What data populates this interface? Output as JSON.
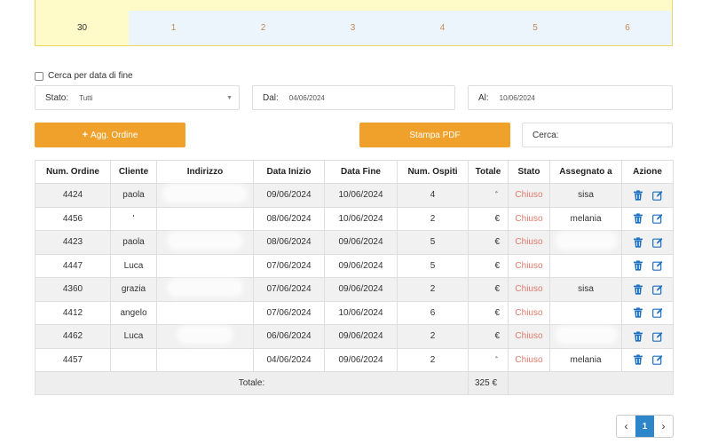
{
  "calendar": {
    "days": [
      "30",
      "1",
      "2",
      "3",
      "4",
      "5",
      "6"
    ]
  },
  "filters": {
    "end_date_checkbox_label": "Cerca per data di fine",
    "stato_label": "Stato:",
    "stato_value": "Tutti",
    "dal_label": "Dal:",
    "dal_value": "04/06/2024",
    "al_label": "Al:",
    "al_value": "10/06/2024"
  },
  "buttons": {
    "add_order": "Agg. Ordine",
    "print_pdf": "Stampa PDF"
  },
  "search": {
    "label": "Cerca:"
  },
  "table": {
    "headers": [
      "Num. Ordine",
      "Cliente",
      "Indirizzo",
      "Data Inizio",
      "Data Fine",
      "Num. Ospiti",
      "Totale",
      "Stato",
      "Assegnato a",
      "Azione"
    ],
    "rows": [
      {
        "num": "4424",
        "cliente": "paola",
        "inizio": "09/06/2024",
        "fine": "10/06/2024",
        "ospiti": "4",
        "totale": "ﾞ",
        "stato": "Chiuso",
        "assegnato": "sisa"
      },
      {
        "num": "4456",
        "cliente": "'",
        "inizio": "08/06/2024",
        "fine": "10/06/2024",
        "ospiti": "2",
        "totale": "€",
        "stato": "Chiuso",
        "assegnato": "melania"
      },
      {
        "num": "4423",
        "cliente": "paola",
        "inizio": "08/06/2024",
        "fine": "09/06/2024",
        "ospiti": "5",
        "totale": "€",
        "stato": "Chiuso",
        "assegnato": ""
      },
      {
        "num": "4447",
        "cliente": "Luca",
        "inizio": "07/06/2024",
        "fine": "09/06/2024",
        "ospiti": "5",
        "totale": "€",
        "stato": "Chiuso",
        "assegnato": ""
      },
      {
        "num": "4360",
        "cliente": "grazia",
        "inizio": "07/06/2024",
        "fine": "09/06/2024",
        "ospiti": "2",
        "totale": "€",
        "stato": "Chiuso",
        "assegnato": "sisa"
      },
      {
        "num": "4412",
        "cliente": "angelo",
        "inizio": "07/06/2024",
        "fine": "10/06/2024",
        "ospiti": "6",
        "totale": "€",
        "stato": "Chiuso",
        "assegnato": ""
      },
      {
        "num": "4462",
        "cliente": "Luca",
        "inizio": "06/06/2024",
        "fine": "09/06/2024",
        "ospiti": "2",
        "totale": "€",
        "stato": "Chiuso",
        "assegnato": ""
      },
      {
        "num": "4457",
        "cliente": "",
        "inizio": "04/06/2024",
        "fine": "09/06/2024",
        "ospiti": "2",
        "totale": "ﾞ",
        "stato": "Chiuso",
        "assegnato": "melania"
      }
    ],
    "total_label": "Totale:",
    "total_value": "325 €"
  },
  "pagination": {
    "prev": "‹",
    "current": "1",
    "next": "›"
  },
  "colors": {
    "accent": "#f0a12b",
    "state": "#e07a6a",
    "icon": "#1a6fc0",
    "page_active": "#2c86c9"
  },
  "icons": {
    "delete": "trash-icon",
    "edit": "edit-icon"
  }
}
